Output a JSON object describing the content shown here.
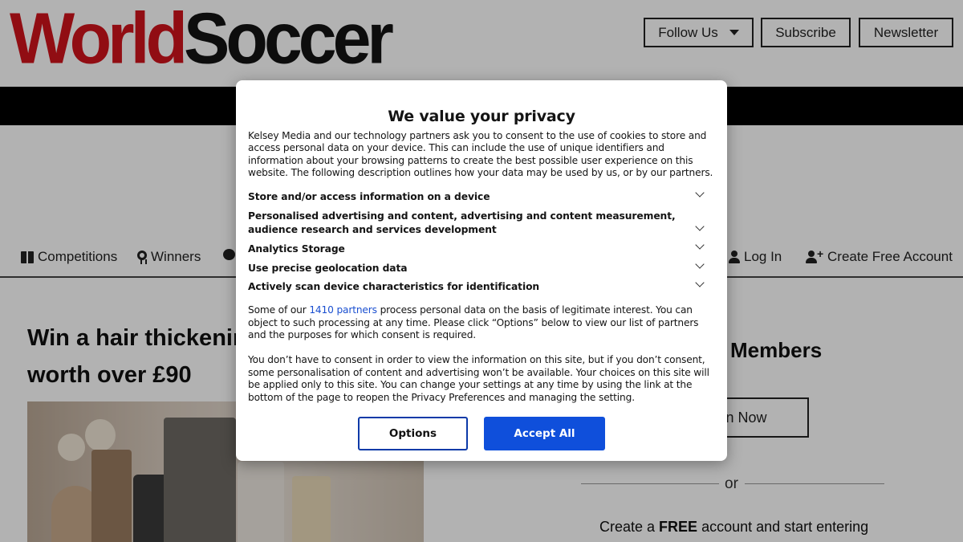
{
  "header": {
    "logo_part1": "World",
    "logo_part2": "Soccer",
    "follow_label": "Follow Us",
    "subscribe_label": "Subscribe",
    "newsletter_label": "Newsletter"
  },
  "subnav": {
    "competitions": "Competitions",
    "winners": "Winners",
    "login": "Log In",
    "create_account": "Create Free Account"
  },
  "article": {
    "title_line1": "Win a hair thickening",
    "title_line2": "worth over £90"
  },
  "sidebar": {
    "members_title": "Members",
    "join_label": "n Now",
    "or_text": "or",
    "create_text_pre": "Create a ",
    "create_text_bold": "FREE",
    "create_text_post": " account and start entering"
  },
  "consent": {
    "title": "We value your privacy",
    "intro": "Kelsey Media and our technology partners ask you to consent to the use of cookies to store and access personal data on your device. This can include the use of unique identifiers and information about your browsing patterns to create the best possible user experience on this website. The following description outlines how your data may be used by us, or by our partners.",
    "purposes": [
      "Store and/or access information on a device",
      "Personalised advertising and content, advertising and content measurement, audience research and services development",
      "Analytics Storage",
      "Use precise geolocation data",
      "Actively scan device characteristics for identification"
    ],
    "legit_pre": "Some of our ",
    "partners_link": "1410 partners",
    "legit_post": " process personal data on the basis of legitimate interest. You can object to such processing at any time. Please click “Options” below to view our list of partners and the purposes for which consent is required.",
    "no_consent": "You don’t have to consent in order to view the information on this site, but if you don’t consent, some personalisation of content and advertising won’t be available. Your choices on this site will be applied only to this site. You can change your settings at any time by using the link at the bottom of the page to reopen the Privacy Preferences and managing the setting.",
    "options_label": "Options",
    "accept_label": "Accept All"
  },
  "colors": {
    "brand_red": "#d0141c",
    "accept_blue": "#0f4fdb",
    "link_blue": "#1a4fd0"
  }
}
